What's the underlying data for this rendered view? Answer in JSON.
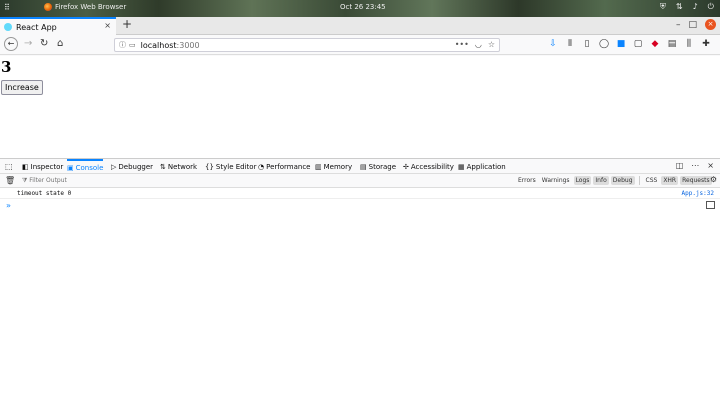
{
  "os": {
    "app_name": "Firefox Web Browser",
    "clock": "Oct 26  23:45"
  },
  "browser": {
    "tab_title": "React App",
    "url_host": "localhost",
    "url_port": ":3000",
    "new_tab": "+",
    "tab_close": "×"
  },
  "page": {
    "count": "3",
    "button_label": "Increase"
  },
  "devtools": {
    "tabs": [
      {
        "label": "Inspector",
        "icon": "inspector-icon"
      },
      {
        "label": "Console",
        "icon": "console-icon"
      },
      {
        "label": "Debugger",
        "icon": "debugger-icon"
      },
      {
        "label": "Network",
        "icon": "network-icon"
      },
      {
        "label": "Style Editor",
        "icon": "style-editor-icon"
      },
      {
        "label": "Performance",
        "icon": "performance-icon"
      },
      {
        "label": "Memory",
        "icon": "memory-icon"
      },
      {
        "label": "Storage",
        "icon": "storage-icon"
      },
      {
        "label": "Accessibility",
        "icon": "accessibility-icon"
      },
      {
        "label": "Application",
        "icon": "application-icon"
      }
    ],
    "active_tab": "Console",
    "filter_placeholder": "Filter Output",
    "levels": [
      "Errors",
      "Warnings",
      "Logs",
      "Info",
      "Debug"
    ],
    "extras": [
      "CSS",
      "XHR",
      "Requests"
    ],
    "log": {
      "message": "timeout state 0",
      "source": "App.js:32"
    },
    "prompt": "»"
  },
  "colors": {
    "accent": "#0a84ff",
    "close_button": "#e95420"
  }
}
